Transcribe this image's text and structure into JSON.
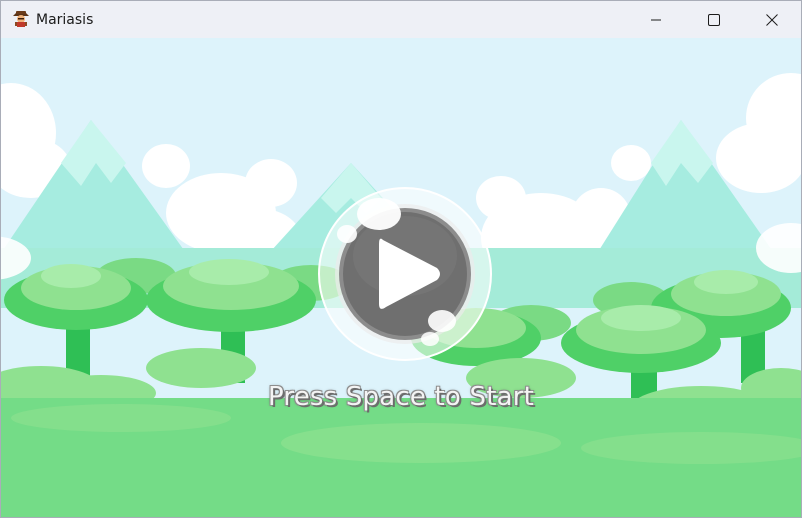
{
  "window": {
    "title": "Mariasis",
    "app_icon": "character-icon",
    "controls": [
      "minimize-icon",
      "maximize-icon",
      "close-icon"
    ]
  },
  "game": {
    "start_prompt": "Press Space to Start",
    "play_button_icon": "play-icon",
    "colors": {
      "sky": "#ddf3fb",
      "mountain": "#9ee6da",
      "forest_light": "#9be79d",
      "forest_dark": "#2fbf55",
      "ground": "#6fdc85",
      "play_button": "#6f6f6f"
    }
  }
}
